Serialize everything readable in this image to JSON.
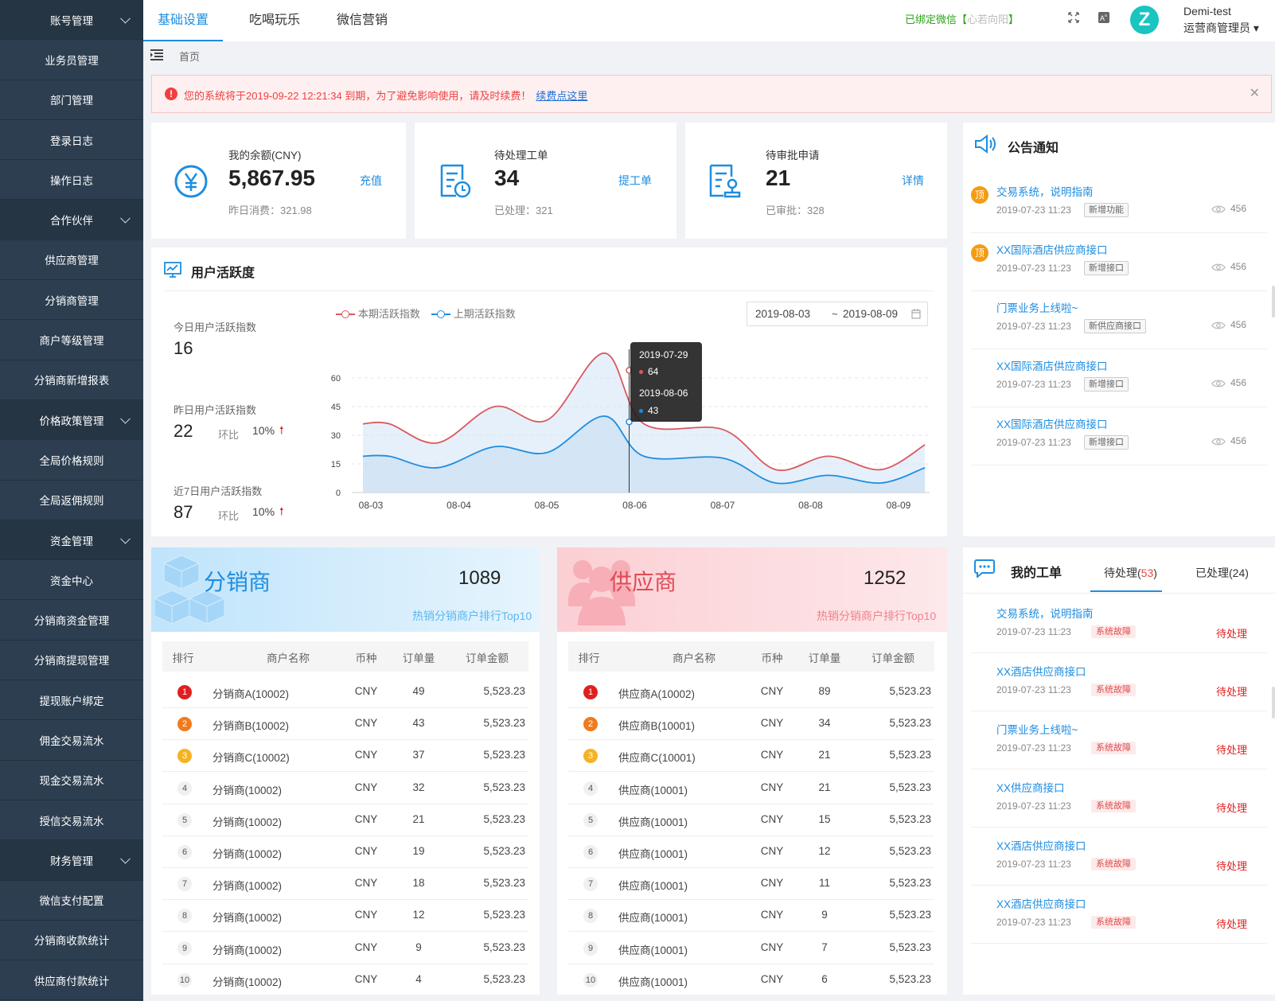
{
  "sidebar": [
    {
      "label": "账号管理",
      "group": true
    },
    {
      "label": "业务员管理",
      "group": false
    },
    {
      "label": "部门管理",
      "group": false
    },
    {
      "label": "登录日志",
      "group": false
    },
    {
      "label": "操作日志",
      "group": false
    },
    {
      "label": "合作伙伴",
      "group": true
    },
    {
      "label": "供应商管理",
      "group": false
    },
    {
      "label": "分销商管理",
      "group": false
    },
    {
      "label": "商户等级管理",
      "group": false
    },
    {
      "label": "分销商新增报表",
      "group": false
    },
    {
      "label": "价格政策管理",
      "group": true
    },
    {
      "label": "全局价格规则",
      "group": false
    },
    {
      "label": "全局返佣规则",
      "group": false
    },
    {
      "label": "资金管理",
      "group": true
    },
    {
      "label": "资金中心",
      "group": false
    },
    {
      "label": "分销商资金管理",
      "group": false
    },
    {
      "label": "分销商提现管理",
      "group": false
    },
    {
      "label": "提现账户绑定",
      "group": false
    },
    {
      "label": "佣金交易流水",
      "group": false
    },
    {
      "label": "现金交易流水",
      "group": false
    },
    {
      "label": "授信交易流水",
      "group": false
    },
    {
      "label": "财务管理",
      "group": true
    },
    {
      "label": "微信支付配置",
      "group": false
    },
    {
      "label": "分销商收款统计",
      "group": false
    },
    {
      "label": "供应商付款统计",
      "group": false
    }
  ],
  "topbar": {
    "tabs": [
      "基础设置",
      "吃喝玩乐",
      "微信营销"
    ],
    "wechat_bound": "已绑定微信【",
    "wechat_name": "心若向阳",
    "wechat_close": "】",
    "avatar_letter": "Z",
    "username": "Demi-test",
    "role": "运营商管理员"
  },
  "breadcrumb": "首页",
  "alert": {
    "text": "您的系统将于2019-09-22 12:21:34 到期，为了避免影响使用，请及时续费！",
    "link": "续费点这里"
  },
  "stats": [
    {
      "label": "我的余额(CNY)",
      "value": "5,867.95",
      "sub": "昨日消费：321.98",
      "action": "充值"
    },
    {
      "label": "待处理工单",
      "value": "34",
      "sub": "已处理：321",
      "action": "提工单"
    },
    {
      "label": "待审批申请",
      "value": "21",
      "sub": "已审批：328",
      "action": "详情"
    }
  ],
  "activity": {
    "title": "用户活跃度",
    "today_label": "今日用户活跃指数",
    "today_value": "16",
    "yesterday_label": "昨日用户活跃指数",
    "yesterday_value": "22",
    "week_label": "近7日用户活跃指数",
    "week_value": "87",
    "ratio_label": "环比",
    "ratio_value": "10%",
    "date_start": "2019-08-03",
    "date_sep": "~",
    "date_end": "2019-08-09",
    "tooltip_date1": "2019-07-29",
    "tooltip_val1": "64",
    "tooltip_date2": "2019-08-06",
    "tooltip_val2": "43"
  },
  "chart_data": {
    "type": "area",
    "x": [
      "08-03",
      "08-04",
      "08-05",
      "08-06",
      "08-07",
      "08-08",
      "08-09"
    ],
    "yticks": [
      0,
      15,
      30,
      45,
      60
    ],
    "ylim": [
      0,
      75
    ],
    "series": [
      {
        "name": "本期活跃指数",
        "color": "#d9595f",
        "points": [
          [
            0,
            36
          ],
          [
            0.3,
            36
          ],
          [
            0.85,
            26
          ],
          [
            1.5,
            45
          ],
          [
            2.1,
            38
          ],
          [
            2.75,
            73
          ],
          [
            3.2,
            36
          ],
          [
            4.1,
            33
          ],
          [
            4.7,
            12
          ],
          [
            5.3,
            19
          ],
          [
            5.9,
            12
          ],
          [
            6.4,
            25
          ]
        ]
      },
      {
        "name": "上期活跃指数",
        "color": "#1e8de0",
        "points": [
          [
            0,
            19
          ],
          [
            0.3,
            19
          ],
          [
            0.85,
            13
          ],
          [
            1.5,
            24
          ],
          [
            2.1,
            21
          ],
          [
            2.75,
            40
          ],
          [
            3.2,
            19
          ],
          [
            4.1,
            18
          ],
          [
            4.7,
            5
          ],
          [
            5.3,
            9
          ],
          [
            5.9,
            5
          ],
          [
            6.4,
            13
          ]
        ]
      }
    ]
  },
  "notices": {
    "title": "公告通知",
    "items": [
      {
        "title": "交易系统，说明指南",
        "date": "2019-07-23 11:23",
        "tag": "新增功能",
        "views": "456",
        "top": true,
        "top_label": "顶"
      },
      {
        "title": "XX国际酒店供应商接口",
        "date": "2019-07-23 11:23",
        "tag": "新增接口",
        "views": "456",
        "top": true,
        "top_label": "顶"
      },
      {
        "title": "门票业务上线啦~",
        "date": "2019-07-23 11:23",
        "tag": "新供应商接口",
        "views": "456",
        "top": false,
        "top_label": ""
      },
      {
        "title": "XX国际酒店供应商接口",
        "date": "2019-07-23 11:23",
        "tag": "新增接口",
        "views": "456",
        "top": false,
        "top_label": ""
      },
      {
        "title": "XX国际酒店供应商接口",
        "date": "2019-07-23 11:23",
        "tag": "新增接口",
        "views": "456",
        "top": false,
        "top_label": ""
      }
    ]
  },
  "distributors": {
    "title": "分销商",
    "count": "1089",
    "subtitle": "热销分销商户排行Top10",
    "columns": [
      "排行",
      "商户名称",
      "币种",
      "订单量",
      "订单金额"
    ],
    "rows": [
      [
        "1",
        "分销商A(10002)",
        "CNY",
        "49",
        "5,523.23"
      ],
      [
        "2",
        "分销商B(10002)",
        "CNY",
        "43",
        "5,523.23"
      ],
      [
        "3",
        "分销商C(10002)",
        "CNY",
        "37",
        "5,523.23"
      ],
      [
        "4",
        "分销商(10002)",
        "CNY",
        "32",
        "5,523.23"
      ],
      [
        "5",
        "分销商(10002)",
        "CNY",
        "21",
        "5,523.23"
      ],
      [
        "6",
        "分销商(10002)",
        "CNY",
        "19",
        "5,523.23"
      ],
      [
        "7",
        "分销商(10002)",
        "CNY",
        "18",
        "5,523.23"
      ],
      [
        "8",
        "分销商(10002)",
        "CNY",
        "12",
        "5,523.23"
      ],
      [
        "9",
        "分销商(10002)",
        "CNY",
        "9",
        "5,523.23"
      ],
      [
        "10",
        "分销商(10002)",
        "CNY",
        "4",
        "5,523.23"
      ]
    ]
  },
  "suppliers": {
    "title": "供应商",
    "count": "1252",
    "subtitle": "热销分销商户排行Top10",
    "columns": [
      "排行",
      "商户名称",
      "币种",
      "订单量",
      "订单金额"
    ],
    "rows": [
      [
        "1",
        "供应商A(10002)",
        "CNY",
        "89",
        "5,523.23"
      ],
      [
        "2",
        "供应商B(10001)",
        "CNY",
        "34",
        "5,523.23"
      ],
      [
        "3",
        "供应商C(10001)",
        "CNY",
        "21",
        "5,523.23"
      ],
      [
        "4",
        "供应商(10001)",
        "CNY",
        "21",
        "5,523.23"
      ],
      [
        "5",
        "供应商(10001)",
        "CNY",
        "15",
        "5,523.23"
      ],
      [
        "6",
        "供应商(10001)",
        "CNY",
        "12",
        "5,523.23"
      ],
      [
        "7",
        "供应商(10001)",
        "CNY",
        "11",
        "5,523.23"
      ],
      [
        "8",
        "供应商(10001)",
        "CNY",
        "9",
        "5,523.23"
      ],
      [
        "9",
        "供应商(10001)",
        "CNY",
        "7",
        "5,523.23"
      ],
      [
        "10",
        "供应商(10001)",
        "CNY",
        "6",
        "5,523.23"
      ]
    ]
  },
  "tickets": {
    "title": "我的工单",
    "tab_pending": "待处理(",
    "pending_count": "53",
    "tab_pending_end": ")",
    "tab_done": "已处理(24)",
    "items": [
      {
        "title": "交易系统，说明指南",
        "date": "2019-07-23 11:23",
        "tag": "系统故障",
        "status": "待处理"
      },
      {
        "title": "XX酒店供应商接口",
        "date": "2019-07-23 11:23",
        "tag": "系统故障",
        "status": "待处理"
      },
      {
        "title": "门票业务上线啦~",
        "date": "2019-07-23 11:23",
        "tag": "系统故障",
        "status": "待处理"
      },
      {
        "title": "XX供应商接口",
        "date": "2019-07-23 11:23",
        "tag": "系统故障",
        "status": "待处理"
      },
      {
        "title": "XX酒店供应商接口",
        "date": "2019-07-23 11:23",
        "tag": "系统故障",
        "status": "待处理"
      },
      {
        "title": "XX酒店供应商接口",
        "date": "2019-07-23 11:23",
        "tag": "系统故障",
        "status": "待处理"
      }
    ]
  },
  "colors": {
    "accent": "#1e8de0",
    "sidebar": "#2c3e50",
    "danger": "#f04040",
    "success": "#2aa515"
  }
}
